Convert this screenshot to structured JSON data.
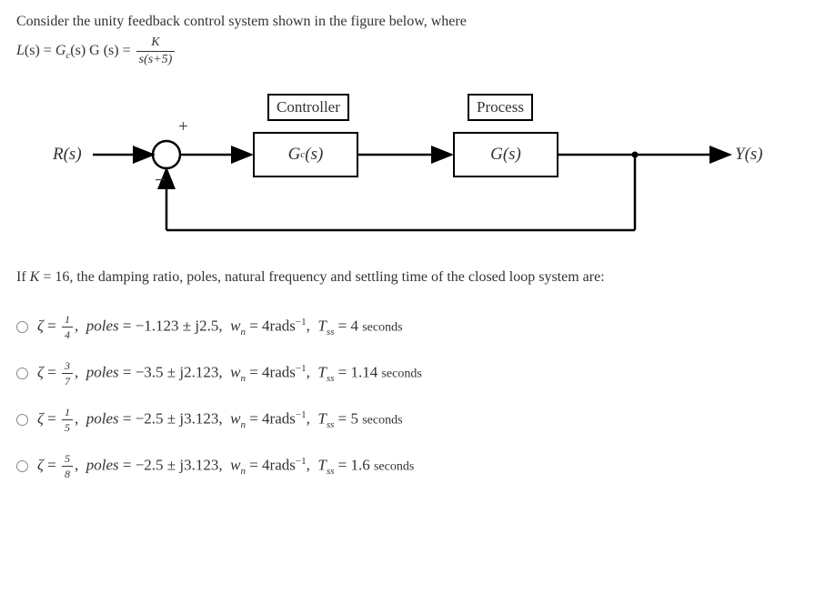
{
  "question_prefix": "Consider the unity feedback control system shown in the figure below, where",
  "lhs_L": "L",
  "lhs_s": "(s)",
  "eq": " = ",
  "Gc": "G",
  "c_sub": "c",
  "sG": "(s) G (s) = ",
  "frac_num": "K",
  "frac_den": "s(s+5)",
  "diagram": {
    "controller": "Controller",
    "process": "Process",
    "gc": "G",
    "gc_sub": "c",
    "gc_s": "(s)",
    "g": "G(s)",
    "r": "R(s)",
    "y": "Y(s)",
    "plus": "+",
    "minus": "−"
  },
  "followup_prefix": "If ",
  "followup_K": "K",
  "followup_eq": " = 16",
  "followup_rest": ", the damping ratio, poles, natural frequency and settling time of the closed loop system are:",
  "options": [
    {
      "zeta_num": "1",
      "zeta_den": "4",
      "poles": "−1.123 ± j2.5",
      "wn": "4rads",
      "tss": "4",
      "tss_unit": "seconds"
    },
    {
      "zeta_num": "3",
      "zeta_den": "7",
      "poles": "−3.5 ± j2.123",
      "wn": "4rads",
      "tss": "1.14",
      "tss_unit": "seconds"
    },
    {
      "zeta_num": "1",
      "zeta_den": "5",
      "poles": "−2.5 ± j3.123",
      "wn": "4rads",
      "tss": "5",
      "tss_unit": "seconds"
    },
    {
      "zeta_num": "5",
      "zeta_den": "8",
      "poles": "−2.5 ± j3.123",
      "wn": "4rads",
      "tss": "1.6",
      "tss_unit": "seconds"
    }
  ],
  "sym": {
    "zeta": "ζ",
    "poles_label": "poles",
    "wn": "w",
    "wn_sub": "n",
    "tss": "T",
    "tss_sub": "ss",
    "neg1": "−1"
  }
}
